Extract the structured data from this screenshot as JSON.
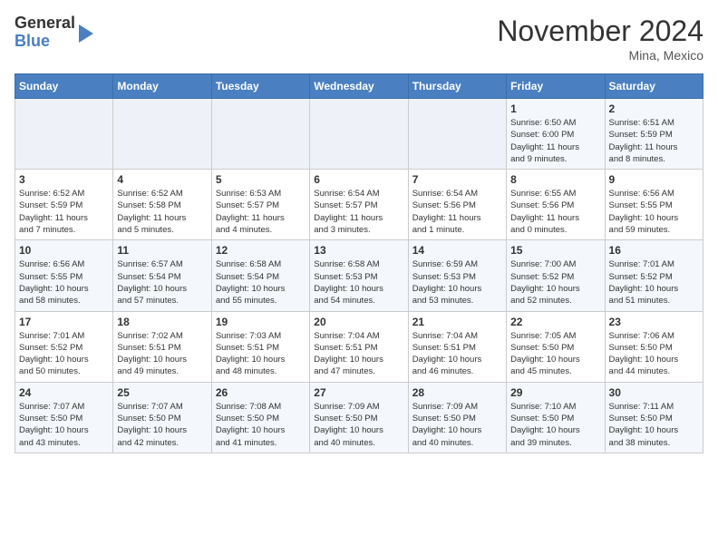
{
  "header": {
    "logo_line1": "General",
    "logo_line2": "Blue",
    "title": "November 2024",
    "subtitle": "Mina, Mexico"
  },
  "calendar": {
    "days_of_week": [
      "Sunday",
      "Monday",
      "Tuesday",
      "Wednesday",
      "Thursday",
      "Friday",
      "Saturday"
    ],
    "weeks": [
      [
        {
          "day": "",
          "info": ""
        },
        {
          "day": "",
          "info": ""
        },
        {
          "day": "",
          "info": ""
        },
        {
          "day": "",
          "info": ""
        },
        {
          "day": "",
          "info": ""
        },
        {
          "day": "1",
          "info": "Sunrise: 6:50 AM\nSunset: 6:00 PM\nDaylight: 11 hours\nand 9 minutes."
        },
        {
          "day": "2",
          "info": "Sunrise: 6:51 AM\nSunset: 5:59 PM\nDaylight: 11 hours\nand 8 minutes."
        }
      ],
      [
        {
          "day": "3",
          "info": "Sunrise: 6:52 AM\nSunset: 5:59 PM\nDaylight: 11 hours\nand 7 minutes."
        },
        {
          "day": "4",
          "info": "Sunrise: 6:52 AM\nSunset: 5:58 PM\nDaylight: 11 hours\nand 5 minutes."
        },
        {
          "day": "5",
          "info": "Sunrise: 6:53 AM\nSunset: 5:57 PM\nDaylight: 11 hours\nand 4 minutes."
        },
        {
          "day": "6",
          "info": "Sunrise: 6:54 AM\nSunset: 5:57 PM\nDaylight: 11 hours\nand 3 minutes."
        },
        {
          "day": "7",
          "info": "Sunrise: 6:54 AM\nSunset: 5:56 PM\nDaylight: 11 hours\nand 1 minute."
        },
        {
          "day": "8",
          "info": "Sunrise: 6:55 AM\nSunset: 5:56 PM\nDaylight: 11 hours\nand 0 minutes."
        },
        {
          "day": "9",
          "info": "Sunrise: 6:56 AM\nSunset: 5:55 PM\nDaylight: 10 hours\nand 59 minutes."
        }
      ],
      [
        {
          "day": "10",
          "info": "Sunrise: 6:56 AM\nSunset: 5:55 PM\nDaylight: 10 hours\nand 58 minutes."
        },
        {
          "day": "11",
          "info": "Sunrise: 6:57 AM\nSunset: 5:54 PM\nDaylight: 10 hours\nand 57 minutes."
        },
        {
          "day": "12",
          "info": "Sunrise: 6:58 AM\nSunset: 5:54 PM\nDaylight: 10 hours\nand 55 minutes."
        },
        {
          "day": "13",
          "info": "Sunrise: 6:58 AM\nSunset: 5:53 PM\nDaylight: 10 hours\nand 54 minutes."
        },
        {
          "day": "14",
          "info": "Sunrise: 6:59 AM\nSunset: 5:53 PM\nDaylight: 10 hours\nand 53 minutes."
        },
        {
          "day": "15",
          "info": "Sunrise: 7:00 AM\nSunset: 5:52 PM\nDaylight: 10 hours\nand 52 minutes."
        },
        {
          "day": "16",
          "info": "Sunrise: 7:01 AM\nSunset: 5:52 PM\nDaylight: 10 hours\nand 51 minutes."
        }
      ],
      [
        {
          "day": "17",
          "info": "Sunrise: 7:01 AM\nSunset: 5:52 PM\nDaylight: 10 hours\nand 50 minutes."
        },
        {
          "day": "18",
          "info": "Sunrise: 7:02 AM\nSunset: 5:51 PM\nDaylight: 10 hours\nand 49 minutes."
        },
        {
          "day": "19",
          "info": "Sunrise: 7:03 AM\nSunset: 5:51 PM\nDaylight: 10 hours\nand 48 minutes."
        },
        {
          "day": "20",
          "info": "Sunrise: 7:04 AM\nSunset: 5:51 PM\nDaylight: 10 hours\nand 47 minutes."
        },
        {
          "day": "21",
          "info": "Sunrise: 7:04 AM\nSunset: 5:51 PM\nDaylight: 10 hours\nand 46 minutes."
        },
        {
          "day": "22",
          "info": "Sunrise: 7:05 AM\nSunset: 5:50 PM\nDaylight: 10 hours\nand 45 minutes."
        },
        {
          "day": "23",
          "info": "Sunrise: 7:06 AM\nSunset: 5:50 PM\nDaylight: 10 hours\nand 44 minutes."
        }
      ],
      [
        {
          "day": "24",
          "info": "Sunrise: 7:07 AM\nSunset: 5:50 PM\nDaylight: 10 hours\nand 43 minutes."
        },
        {
          "day": "25",
          "info": "Sunrise: 7:07 AM\nSunset: 5:50 PM\nDaylight: 10 hours\nand 42 minutes."
        },
        {
          "day": "26",
          "info": "Sunrise: 7:08 AM\nSunset: 5:50 PM\nDaylight: 10 hours\nand 41 minutes."
        },
        {
          "day": "27",
          "info": "Sunrise: 7:09 AM\nSunset: 5:50 PM\nDaylight: 10 hours\nand 40 minutes."
        },
        {
          "day": "28",
          "info": "Sunrise: 7:09 AM\nSunset: 5:50 PM\nDaylight: 10 hours\nand 40 minutes."
        },
        {
          "day": "29",
          "info": "Sunrise: 7:10 AM\nSunset: 5:50 PM\nDaylight: 10 hours\nand 39 minutes."
        },
        {
          "day": "30",
          "info": "Sunrise: 7:11 AM\nSunset: 5:50 PM\nDaylight: 10 hours\nand 38 minutes."
        }
      ]
    ]
  }
}
